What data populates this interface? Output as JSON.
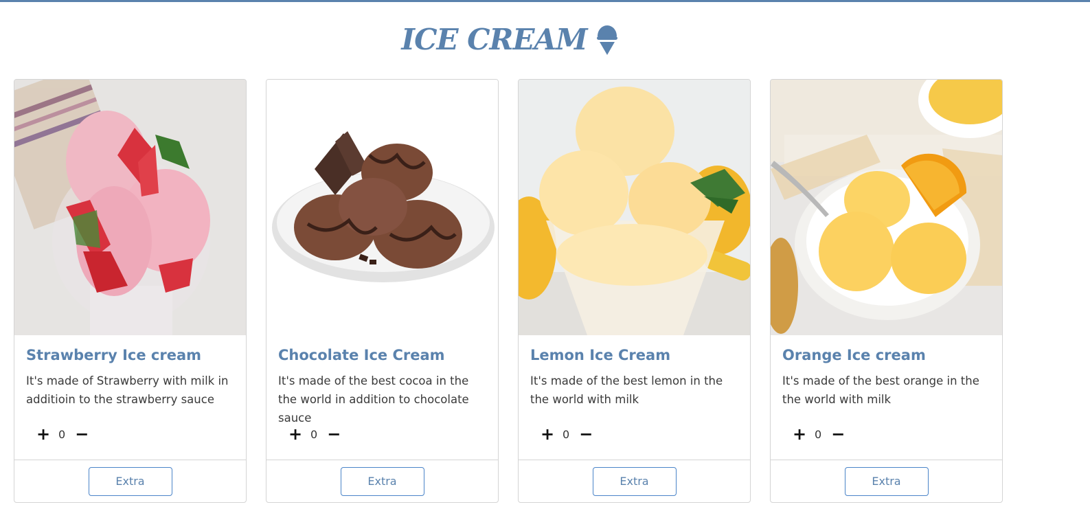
{
  "header": {
    "title": "ICE CREAM",
    "icon": "ice-cream-cone-icon",
    "accent_color": "#5a82ad"
  },
  "cards": [
    {
      "title": "Strawberry Ice cream",
      "description": "It's made of Strawberry with milk in additioin to the strawberry sauce",
      "quantity": "0",
      "plus_label": "+",
      "minus_label": "−",
      "extra_label": "Extra",
      "image": "strawberry-ice-cream-image"
    },
    {
      "title": "Chocolate Ice Cream",
      "description": "It's made of the best cocoa in the the world in addition to chocolate sauce",
      "quantity": "0",
      "plus_label": "+",
      "minus_label": "−",
      "extra_label": "Extra",
      "image": "chocolate-ice-cream-image"
    },
    {
      "title": "Lemon Ice Cream",
      "description": "It's made of the best lemon in the the world with milk",
      "quantity": "0",
      "plus_label": "+",
      "minus_label": "−",
      "extra_label": "Extra",
      "image": "lemon-ice-cream-image"
    },
    {
      "title": "Orange Ice cream",
      "description": "It's made of the best orange in the the world with milk",
      "quantity": "0",
      "plus_label": "+",
      "minus_label": "−",
      "extra_label": "Extra",
      "image": "orange-ice-cream-image"
    }
  ]
}
